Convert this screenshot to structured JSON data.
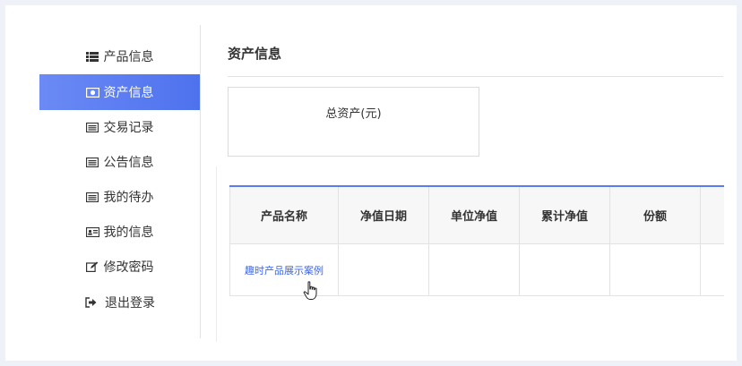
{
  "sidebar": {
    "items": [
      {
        "label": "产品信息",
        "icon": "list-icon",
        "active": false
      },
      {
        "label": "资产信息",
        "icon": "money-icon",
        "active": true
      },
      {
        "label": "交易记录",
        "icon": "list-alt-icon",
        "active": false
      },
      {
        "label": "公告信息",
        "icon": "list-alt-icon",
        "active": false
      },
      {
        "label": "我的待办",
        "icon": "list-alt-icon",
        "active": false
      },
      {
        "label": "我的信息",
        "icon": "id-card-icon",
        "active": false
      },
      {
        "label": "修改密码",
        "icon": "edit-icon",
        "active": false
      },
      {
        "label": "退出登录",
        "icon": "sign-out-icon",
        "active": false
      }
    ]
  },
  "main": {
    "title": "资产信息",
    "asset_box": {
      "label": "总资产(元)"
    },
    "table": {
      "headers": [
        "产品名称",
        "净值日期",
        "单位净值",
        "累计净值",
        "份额",
        ""
      ],
      "rows": [
        [
          "趣时产品展示案例",
          "",
          "",
          "",
          "",
          ""
        ]
      ]
    }
  },
  "colors": {
    "accent": "#4e72ee",
    "link": "#3f66e3"
  }
}
